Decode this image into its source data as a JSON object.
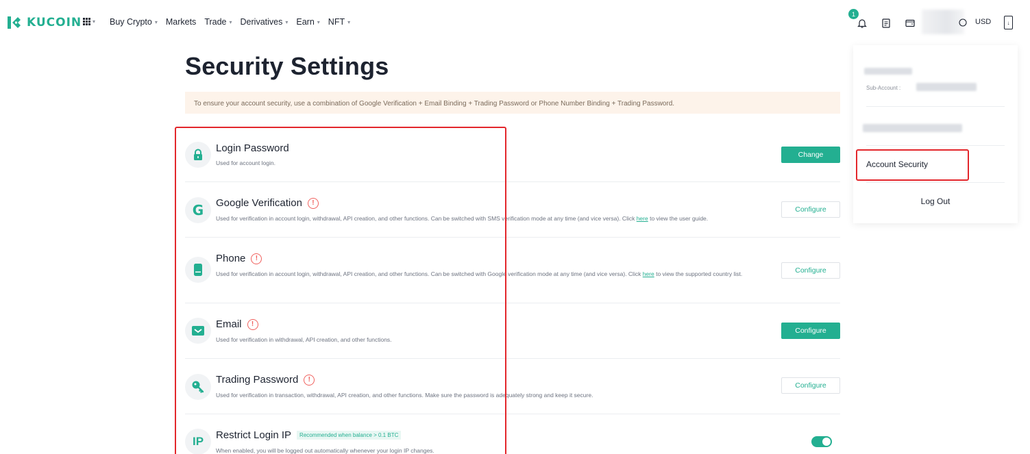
{
  "brand": {
    "name": "KUCOIN",
    "accent": "#23af91"
  },
  "nav": {
    "items": [
      {
        "label": "Buy Crypto",
        "has_dropdown": true
      },
      {
        "label": "Markets",
        "has_dropdown": false
      },
      {
        "label": "Trade",
        "has_dropdown": true
      },
      {
        "label": "Derivatives",
        "has_dropdown": true
      },
      {
        "label": "Earn",
        "has_dropdown": true
      },
      {
        "label": "NFT",
        "has_dropdown": true
      }
    ],
    "notification_count": "1",
    "currency": "USD",
    "icons": [
      "apps-grid-icon",
      "bell-icon",
      "orders-icon",
      "wallet-icon",
      "globe-icon",
      "download-icon"
    ]
  },
  "page": {
    "title": "Security Settings",
    "notice": "To ensure your account security, use a combination of Google Verification + Email Binding + Trading Password or Phone Number Binding + Trading Password."
  },
  "settings": [
    {
      "title": "Login Password",
      "desc": "Used for account login.",
      "action": "Change",
      "action_style": "solid",
      "warning": false,
      "icon": "lock-icon"
    },
    {
      "title": "Google Verification",
      "desc_before": "Used for verification in account login, withdrawal, API creation, and other functions. Can be switched with SMS verification mode at any time (and vice versa). Click ",
      "link": "here",
      "desc_after": " to view the user guide.",
      "action": "Configure",
      "action_style": "outline",
      "warning": true,
      "icon": "google-icon"
    },
    {
      "title": "Phone",
      "desc_before": "Used for verification in account login, withdrawal, API creation, and other functions. Can be switched with Google verification mode at any time (and vice versa). Click ",
      "link": "here",
      "desc_after": " to view the supported country list.",
      "action": "Configure",
      "action_style": "outline",
      "warning": true,
      "icon": "phone-icon"
    },
    {
      "title": "Email",
      "desc": "Used for verification in withdrawal, API creation, and other functions.",
      "action": "Configure",
      "action_style": "solid",
      "warning": true,
      "icon": "mail-icon"
    },
    {
      "title": "Trading Password",
      "desc": "Used for verification in transaction, withdrawal, API creation, and other functions. Make sure the password is adequately strong and keep it secure.",
      "action": "Configure",
      "action_style": "outline",
      "warning": true,
      "icon": "key-icon"
    },
    {
      "title": "Restrict Login IP",
      "tag": "Recommended when balance > 0.1 BTC",
      "desc": "When enabled, you will be logged out automatically whenever your login IP changes.",
      "toggle_on": true,
      "icon": "ip-icon",
      "icon_text": "IP"
    }
  ],
  "dropdown": {
    "sub_account_label": "Sub-Account :",
    "items": [
      "Account Security"
    ],
    "logout": "Log Out"
  },
  "colors": {
    "highlight": "#e3262b",
    "warning": "#f0605d",
    "notice_bg": "#fdf3ea"
  }
}
